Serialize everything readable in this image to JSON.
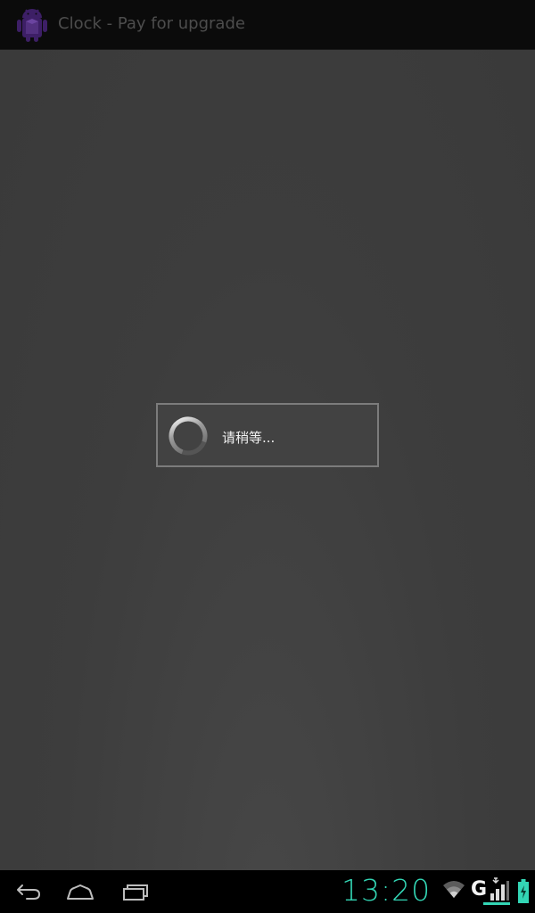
{
  "app": {
    "title": "Clock - Pay for upgrade",
    "icon": "android-robot-icon"
  },
  "dialog": {
    "message": "请稍等...",
    "indicator": "loading-spinner-icon"
  },
  "navigation": {
    "back_icon": "back-icon",
    "home_icon": "home-icon",
    "recents_icon": "recent-apps-icon"
  },
  "status": {
    "time": "13:20",
    "network_type": "G",
    "wifi_icon": "wifi-icon",
    "signal_icon": "signal-icon",
    "battery_icon": "battery-charging-icon",
    "accent_color": "#33d6b5"
  }
}
